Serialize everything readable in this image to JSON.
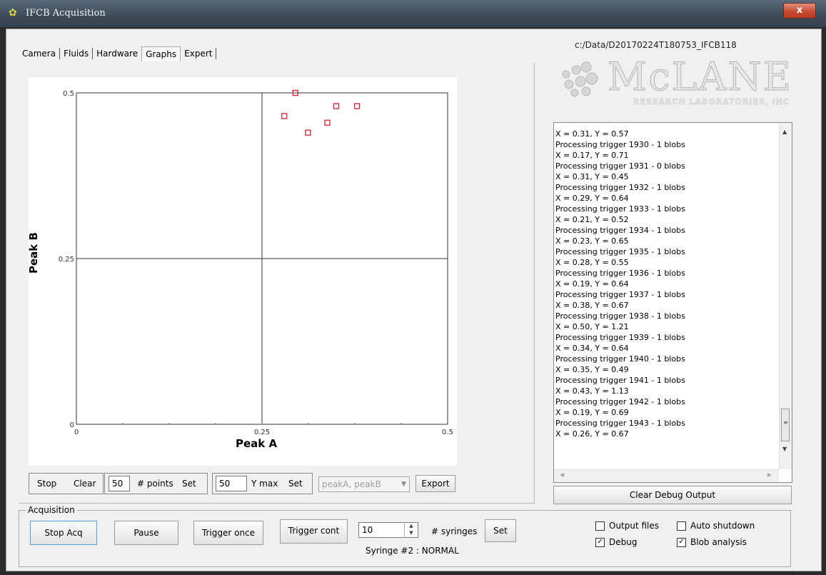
{
  "window": {
    "title": "IFCB Acquisition",
    "close_label": "x"
  },
  "tabs": [
    "Camera",
    "Fluids",
    "Hardware",
    "Graphs",
    "Expert"
  ],
  "active_tab": "Graphs",
  "chart_data": {
    "type": "scatter",
    "xlabel": "Peak A",
    "ylabel": "Peak B",
    "xlim": [
      0,
      0.5
    ],
    "ylim": [
      0,
      0.5
    ],
    "xticks": [
      "0",
      "0.25",
      "0.5"
    ],
    "yticks": [
      "0",
      "0.25",
      "0.5"
    ],
    "grid": "center crosshair",
    "marker": "open-square",
    "marker_color": "#cc2233",
    "points": [
      {
        "x": 0.28,
        "y": 0.465
      },
      {
        "x": 0.295,
        "y": 0.5
      },
      {
        "x": 0.312,
        "y": 0.44
      },
      {
        "x": 0.338,
        "y": 0.455
      },
      {
        "x": 0.35,
        "y": 0.48
      },
      {
        "x": 0.378,
        "y": 0.48
      }
    ]
  },
  "graph_controls": {
    "stop_label": "Stop",
    "clear_label": "Clear",
    "points_value": "50",
    "points_label": "# points",
    "points_set_label": "Set",
    "ymax_value": "50",
    "ymax_label": "Y max",
    "ymax_set_label": "Set",
    "series_select": "peakA, peakB",
    "export_label": "Export"
  },
  "right_panel": {
    "data_path": "c:/Data/D20170224T180753_IFCB118",
    "logo_main": "McLANE",
    "logo_sub": "RESEARCH LABORATORIES, INC",
    "debug_lines": [
      "X = 0.31, Y = 0.57",
      "Processing trigger 1930 - 1 blobs",
      "X = 0.17, Y = 0.71",
      "Processing trigger 1931 - 0 blobs",
      "X = 0.31, Y = 0.45",
      "Processing trigger 1932 - 1 blobs",
      "X = 0.29, Y = 0.64",
      "Processing trigger 1933 - 1 blobs",
      "X = 0.21, Y = 0.52",
      "Processing trigger 1934 - 1 blobs",
      "X = 0.23, Y = 0.65",
      "Processing trigger 1935 - 1 blobs",
      "X = 0.28, Y = 0.55",
      "Processing trigger 1936 - 1 blobs",
      "X = 0.19, Y = 0.64",
      "Processing trigger 1937 - 1 blobs",
      "X = 0.38, Y = 0.67",
      "Processing trigger 1938 - 1 blobs",
      "X = 0.50, Y = 1.21",
      "Processing trigger 1939 - 1 blobs",
      "X = 0.34, Y = 0.64",
      "Processing trigger 1940 - 1 blobs",
      "X = 0.35, Y = 0.49",
      "Processing trigger 1941 - 1 blobs",
      "X = 0.43, Y = 1.13",
      "Processing trigger 1942 - 1 blobs",
      "X = 0.19, Y = 0.69",
      "Processing trigger 1943 - 1 blobs",
      "X = 0.26, Y = 0.67"
    ],
    "clear_debug_label": "Clear Debug Output"
  },
  "acquisition": {
    "group_label": "Acquisition",
    "stop_acq_label": "Stop Acq",
    "pause_label": "Pause",
    "trigger_once_label": "Trigger once",
    "trigger_cont_label": "Trigger cont",
    "syringes_value": "10",
    "syringes_label": "# syringes",
    "syringes_set_label": "Set",
    "syringe_status": "Syringe #2 : NORMAL"
  },
  "options": {
    "output_files": {
      "label": "Output files",
      "checked": false
    },
    "auto_shutdown": {
      "label": "Auto shutdown",
      "checked": false
    },
    "debug": {
      "label": "Debug",
      "checked": true
    },
    "blob_analysis": {
      "label": "Blob analysis",
      "checked": true
    }
  }
}
